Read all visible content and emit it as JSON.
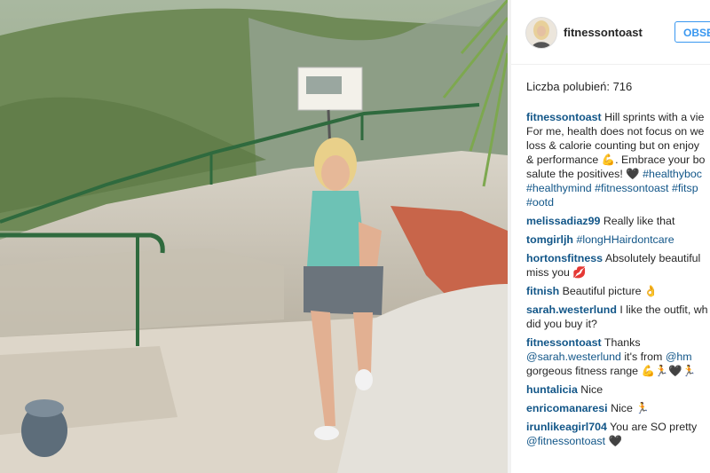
{
  "post": {
    "username": "fitnessontoast",
    "follow_label": "OBSE",
    "likes_label": "Liczba polubień: 716"
  },
  "caption": {
    "user": "fitnessontoast",
    "line1": "Hill sprints with a vie",
    "line2": "For me, health does not focus on we",
    "line3": "loss & calorie counting but on enjoy",
    "line4": "& performance 💪. Embrace your bo",
    "line5": "salute the positives! 🖤",
    "tag1": "#healthyboc",
    "tag2": "#healthymind",
    "tag3": "#fitnessontoast",
    "tag4": "#fitsp",
    "tag5": "#ootd"
  },
  "comments": [
    {
      "user": "melissadiaz99",
      "text": "Really like that"
    },
    {
      "user": "tomgirljh",
      "tag": "#longHHairdontcare"
    },
    {
      "user": "hortonsfitness",
      "text": "Absolutely beautiful",
      "text2": "miss you 💋"
    },
    {
      "user": "fitnish",
      "text": "Beautiful picture 👌"
    },
    {
      "user": "sarah.westerlund",
      "text": "I like the outfit, wh",
      "text2": "did you buy it?"
    },
    {
      "user": "fitnessontoast",
      "text": "Thanks",
      "mention": "@sarah.westerlund",
      "text_mid": "it's from",
      "mention2": "@hm",
      "text2": "gorgeous fitness range 💪🏃🖤🏃"
    },
    {
      "user": "huntalicia",
      "text": "Nice"
    },
    {
      "user": "enricomanaresi",
      "text": "Nice 🏃"
    },
    {
      "user": "irunlikeagirl704",
      "text": "You are SO pretty",
      "mention": "@fitnessontoast",
      "text2": "🖤"
    }
  ],
  "icons": {
    "avatar": "avatar-photo"
  },
  "colors": {
    "link": "#125688",
    "follow": "#3897f0",
    "text": "#262626"
  }
}
